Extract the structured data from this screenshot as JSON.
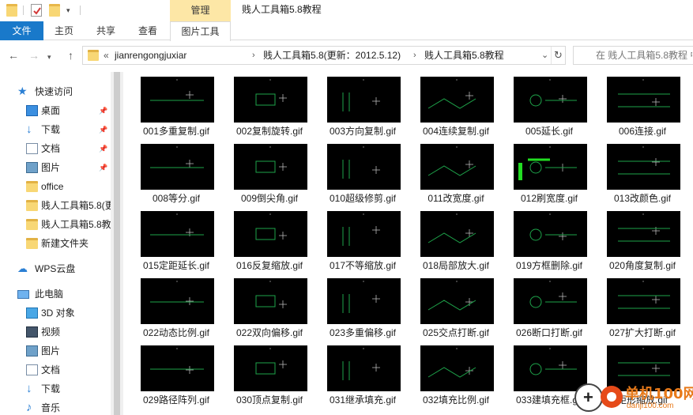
{
  "titlebar": {
    "manage_label": "管理",
    "window_title": "贱人工具箱5.8教程"
  },
  "ribbon": {
    "tabs": [
      "文件",
      "主页",
      "共享",
      "查看",
      "图片工具"
    ]
  },
  "address": {
    "path_prefix": "«",
    "crumbs": [
      "jianrengongjuxiar",
      "贱人工具箱5.8(更新：2012.5.12)",
      "贱人工具箱5.8教程"
    ],
    "search_placeholder": "在 贱人工具箱5.8教程 中搜"
  },
  "nav": {
    "quick_access": "快速访问",
    "items": [
      {
        "label": "桌面",
        "icon": "desktop-icon",
        "pinned": true
      },
      {
        "label": "下载",
        "icon": "download-icon",
        "pinned": true
      },
      {
        "label": "文档",
        "icon": "document-icon",
        "pinned": true
      },
      {
        "label": "图片",
        "icon": "picture-icon",
        "pinned": true
      },
      {
        "label": "office",
        "icon": "folder-icon",
        "pinned": false
      },
      {
        "label": "贱人工具箱5.8(更",
        "icon": "folder-icon",
        "pinned": false
      },
      {
        "label": "贱人工具箱5.8教",
        "icon": "folder-icon",
        "pinned": false
      },
      {
        "label": "新建文件夹",
        "icon": "folder-icon",
        "pinned": false
      }
    ],
    "wps_cloud": "WPS云盘",
    "this_pc": "此电脑",
    "pc_items": [
      {
        "label": "3D 对象",
        "icon": "3d-objects-icon"
      },
      {
        "label": "视频",
        "icon": "video-icon"
      },
      {
        "label": "图片",
        "icon": "picture-icon"
      },
      {
        "label": "文档",
        "icon": "document-icon"
      },
      {
        "label": "下载",
        "icon": "download-icon"
      },
      {
        "label": "音乐",
        "icon": "music-icon"
      }
    ]
  },
  "files": [
    "001多重复制.gif",
    "002复制旋转.gif",
    "003方向复制.gif",
    "004连续复制.gif",
    "005延长.gif",
    "006连接.gif",
    "008等分.gif",
    "009倒尖角.gif",
    "010超级修剪.gif",
    "011改宽度.gif",
    "012刷宽度.gif",
    "013改颜色.gif",
    "015定距延长.gif",
    "016反复缩放.gif",
    "017不等缩放.gif",
    "018局部放大.gif",
    "019方框删除.gif",
    "020角度复制.gif",
    "022动态比例.gif",
    "022双向偏移.gif",
    "023多重偏移.gif",
    "025交点打断.gif",
    "026断口打断.gif",
    "027扩大打断.gif",
    "029路径阵列.gif",
    "030顶点复制.gif",
    "031继承填充.gif",
    "032填充比例.gif",
    "033建填充框.gif",
    "矩形缩放.gif"
  ],
  "watermark": {
    "text": "单机100网",
    "url": "danji100.com"
  }
}
